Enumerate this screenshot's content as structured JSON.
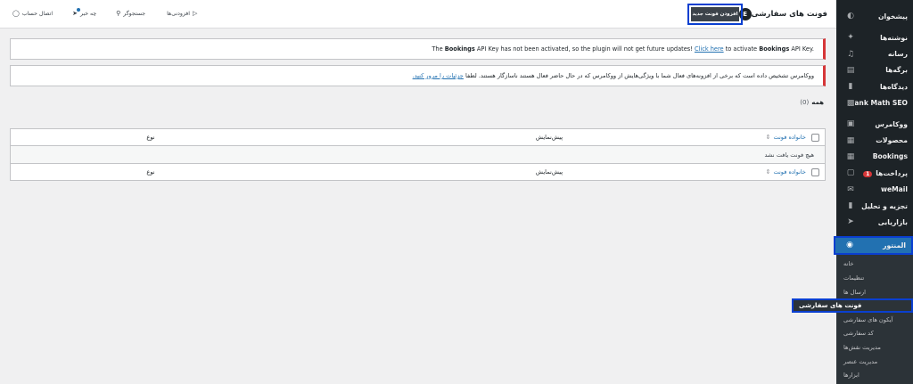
{
  "sidebar": {
    "dashboard": "پیشخوان",
    "items": [
      {
        "label": "نوشته‌ها",
        "icon": "pin-icon"
      },
      {
        "label": "رسانه",
        "icon": "media-icon"
      },
      {
        "label": "برگه‌ها",
        "icon": "pages-icon"
      },
      {
        "label": "دیدگاه‌ها",
        "icon": "comments-icon"
      },
      {
        "label": "Rank Math SEO",
        "icon": "chart-icon"
      }
    ],
    "items2": [
      {
        "label": "ووکامرس",
        "icon": "woo-icon"
      },
      {
        "label": "محصولات",
        "icon": "products-icon"
      },
      {
        "label": "Bookings",
        "icon": "calendar-icon"
      },
      {
        "label": "پرداخت‌ها",
        "icon": "payments-icon",
        "badge": "1"
      },
      {
        "label": "weMail",
        "icon": "mail-icon"
      },
      {
        "label": "تجزیه و تحلیل",
        "icon": "analytics-icon"
      },
      {
        "label": "بازاریابی",
        "icon": "megaphone-icon"
      }
    ],
    "active": "المنتور",
    "submenu": [
      "خانه",
      "تنظیمات",
      "ارسال ها",
      "فونت های سفارشی",
      "آیکون های سفارشی",
      "کد سفارشی",
      "مدیریت نقش‌ها",
      "مدیریت عنصر",
      "ابزارها"
    ]
  },
  "topbar": {
    "title": "فونت های سفارشی",
    "logo_text": "E",
    "add_button": "افزودن فونت جدید",
    "links": {
      "plugins": "افزودنی‌ها",
      "finder": "جستجوگر",
      "whats_new": "چه خبر",
      "connect": "اتصال حساب"
    }
  },
  "notices": {
    "bookings": {
      "prefix": "The ",
      "plugin": "Bookings",
      "middle": " API Key has not been activated, so the plugin will not get future updates! ",
      "link": "Click here",
      "after_link": " to activate ",
      "plugin2": "Bookings",
      "suffix": " API Key."
    },
    "woocommerce": {
      "text": "ووکامرس تشخیص داده است که برخی از افزونه‌های فعال شما با ویژگی‌هایش از ووکامرس که در حال حاضر فعال هستند ناسازگار هستند. لطفا ",
      "link": "جزئیات را مرور کنید."
    }
  },
  "filter": {
    "label": "همه",
    "count": "(0)"
  },
  "table": {
    "columns": {
      "name": "خانواده فونت",
      "preview": "پیش‌نمایش",
      "type": "نوع"
    },
    "empty": "هیچ فونت یافت نشد"
  },
  "colors": {
    "sidebar_bg": "#1d2327",
    "active_bg": "#2271b1",
    "highlight_border": "#0a3fd0",
    "notice_error": "#d63638",
    "link": "#2271b1"
  }
}
